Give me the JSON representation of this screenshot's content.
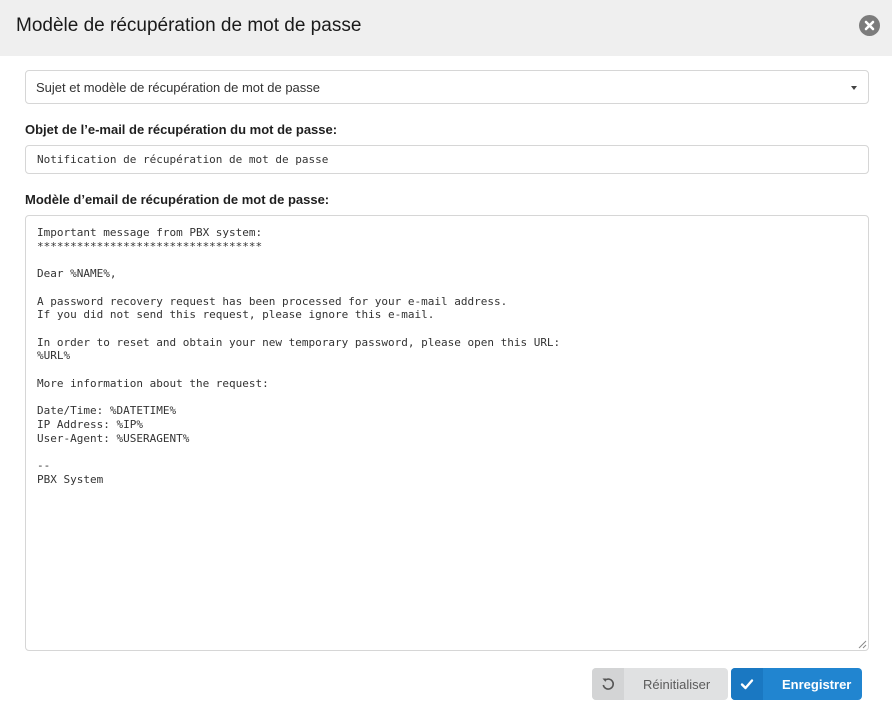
{
  "modal": {
    "title": "Modèle de récupération de mot de passe"
  },
  "template_select": {
    "selected": "Sujet et modèle de récupération de mot de passe"
  },
  "subject": {
    "label": "Objet de l’e-mail de récupération du mot de passe:",
    "value": "Notification de récupération de mot de passe"
  },
  "template": {
    "label": "Modèle d’email de récupération de mot de passe:",
    "body": "Important message from PBX system:\n**********************************\n\nDear %NAME%,\n\nA password recovery request has been processed for your e-mail address.\nIf you did not send this request, please ignore this e-mail.\n\nIn order to reset and obtain your new temporary password, please open this URL:\n%URL%\n\nMore information about the request:\n\nDate/Time: %DATETIME%\nIP Address: %IP%\nUser-Agent: %USERAGENT%\n\n--\nPBX System"
  },
  "buttons": {
    "reset_label": "Réinitialiser",
    "save_label": "Enregistrer"
  },
  "icons": {
    "close": "close-icon",
    "dropdown": "caret-down-icon",
    "reset": "undo-icon",
    "save": "checkmark-icon"
  },
  "colors": {
    "primary": "#2185d0",
    "secondary": "#e0e1e2",
    "header_bg": "#efefef"
  }
}
